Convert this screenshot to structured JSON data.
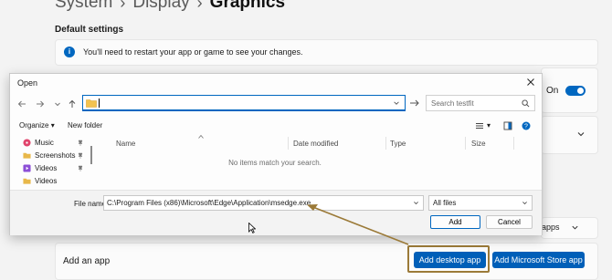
{
  "breadcrumb": {
    "root": "System",
    "mid": "Display",
    "current": "Graphics",
    "separator": "›"
  },
  "default_settings": {
    "title": "Default settings",
    "info_text": "You'll need to restart your app or game to see your changes.",
    "toggle_label": "On",
    "toggle_on": true
  },
  "apps_row": {
    "partial_text": "apps"
  },
  "add_app": {
    "label": "Add an app",
    "desktop_button": "Add desktop app",
    "store_button": "Add Microsoft Store app"
  },
  "dialog": {
    "title": "Open",
    "address": "",
    "search_placeholder": "Search testfit",
    "organize": "Organize",
    "new_folder": "New folder",
    "nav_items": [
      {
        "label": "Music",
        "icon": "music-icon",
        "color": "#e0436b",
        "pinned": true
      },
      {
        "label": "Screenshots",
        "icon": "folder-icon",
        "color": "#e8b84a",
        "pinned": true
      },
      {
        "label": "Videos",
        "icon": "video-library-icon",
        "color": "#8c4fd6",
        "pinned": true
      },
      {
        "label": "Videos",
        "icon": "folder-icon",
        "color": "#e8b84a",
        "pinned": false
      }
    ],
    "columns": [
      "Name",
      "Date modified",
      "Type",
      "Size"
    ],
    "empty_message": "No items match your search.",
    "file_name_label": "File name:",
    "file_name_value": "C:\\Program Files (x86)\\Microsoft\\Edge\\Application\\msedge.exe",
    "file_type": "All files",
    "add_button": "Add",
    "cancel_button": "Cancel"
  },
  "colors": {
    "accent": "#005fb8",
    "annotation": "#9b7a38",
    "window_bg": "#f3f3f3"
  }
}
